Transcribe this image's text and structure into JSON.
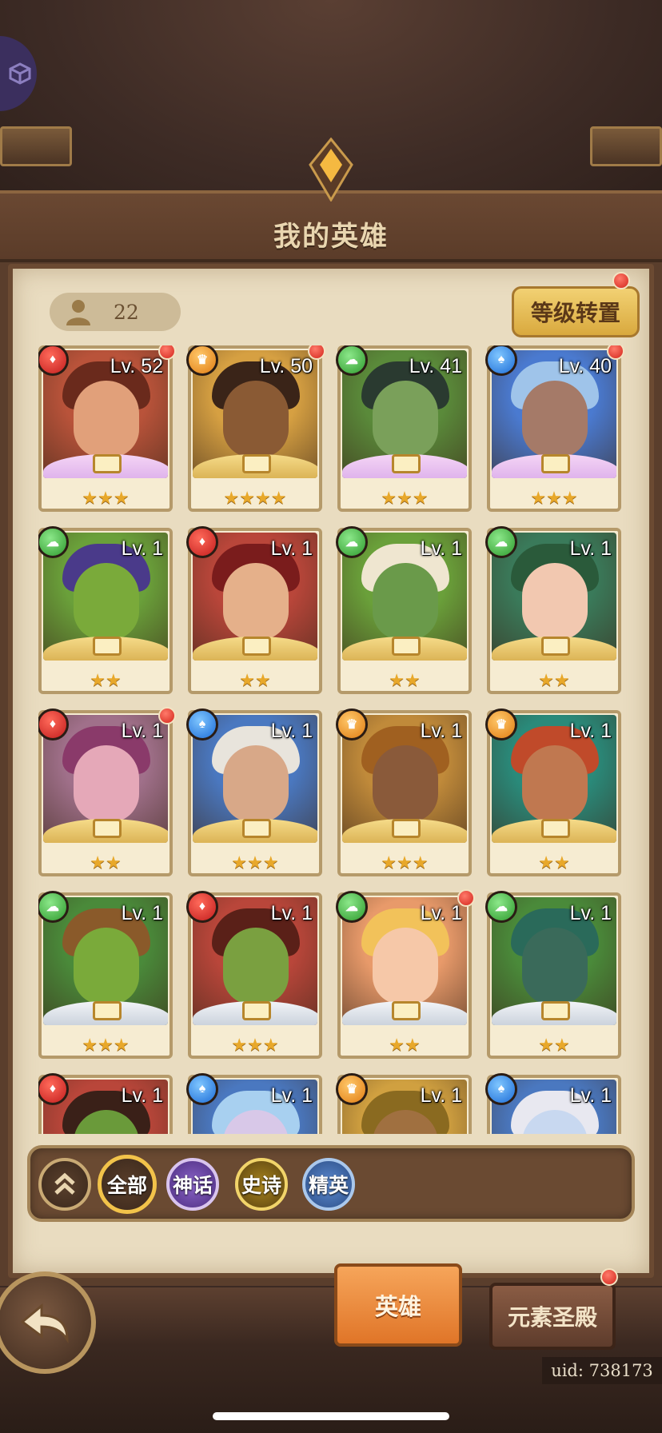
{
  "header": {
    "title": "我的英雄"
  },
  "hero_count": "22",
  "level_transfer_button": "等级转置",
  "heroes": [
    {
      "level": "Lv. 52",
      "element": "fire",
      "stars": "★★★",
      "notify": true
    },
    {
      "level": "Lv. 50",
      "element": "earth",
      "stars": "★★★★",
      "notify": true
    },
    {
      "level": "Lv. 41",
      "element": "wind",
      "stars": "★★★",
      "notify": false
    },
    {
      "level": "Lv. 40",
      "element": "water",
      "stars": "★★★",
      "notify": true
    },
    {
      "level": "Lv. 1",
      "element": "wind",
      "stars": "★★",
      "notify": false
    },
    {
      "level": "Lv. 1",
      "element": "fire",
      "stars": "★★",
      "notify": false
    },
    {
      "level": "Lv. 1",
      "element": "wind",
      "stars": "★★",
      "notify": false
    },
    {
      "level": "Lv. 1",
      "element": "wind",
      "stars": "★★",
      "notify": false
    },
    {
      "level": "Lv. 1",
      "element": "fire",
      "stars": "★★",
      "notify": true
    },
    {
      "level": "Lv. 1",
      "element": "water",
      "stars": "★★★",
      "notify": false
    },
    {
      "level": "Lv. 1",
      "element": "earth",
      "stars": "★★★",
      "notify": false
    },
    {
      "level": "Lv. 1",
      "element": "earth",
      "stars": "★★",
      "notify": false
    },
    {
      "level": "Lv. 1",
      "element": "wind",
      "stars": "★★★",
      "notify": false
    },
    {
      "level": "Lv. 1",
      "element": "fire",
      "stars": "★★★",
      "notify": false
    },
    {
      "level": "Lv. 1",
      "element": "wind",
      "stars": "★★",
      "notify": true
    },
    {
      "level": "Lv. 1",
      "element": "wind",
      "stars": "★★",
      "notify": false
    },
    {
      "level": "Lv. 1",
      "element": "fire",
      "stars": "",
      "notify": false
    },
    {
      "level": "Lv. 1",
      "element": "water",
      "stars": "",
      "notify": false
    },
    {
      "level": "Lv. 1",
      "element": "earth",
      "stars": "",
      "notify": false
    },
    {
      "level": "Lv. 1",
      "element": "water",
      "stars": "",
      "notify": false
    }
  ],
  "filters": {
    "all": "全部",
    "mythic": "神话",
    "epic": "史诗",
    "elite": "精英"
  },
  "tabs": {
    "heroes": "英雄",
    "element_temple": "元素圣殿"
  },
  "uid": "uid: 738173",
  "colors": {
    "fire": "#c21d1d",
    "earth": "#e07c12",
    "wind": "#2f9a2e",
    "water": "#1d6cd6",
    "accent_gold": "#d9a93e",
    "active_tab": "#e07528"
  },
  "icons": {
    "element_fire": "flame-icon",
    "element_earth": "diamond-icon",
    "element_wind": "swirl-icon",
    "element_water": "droplet-icon"
  }
}
